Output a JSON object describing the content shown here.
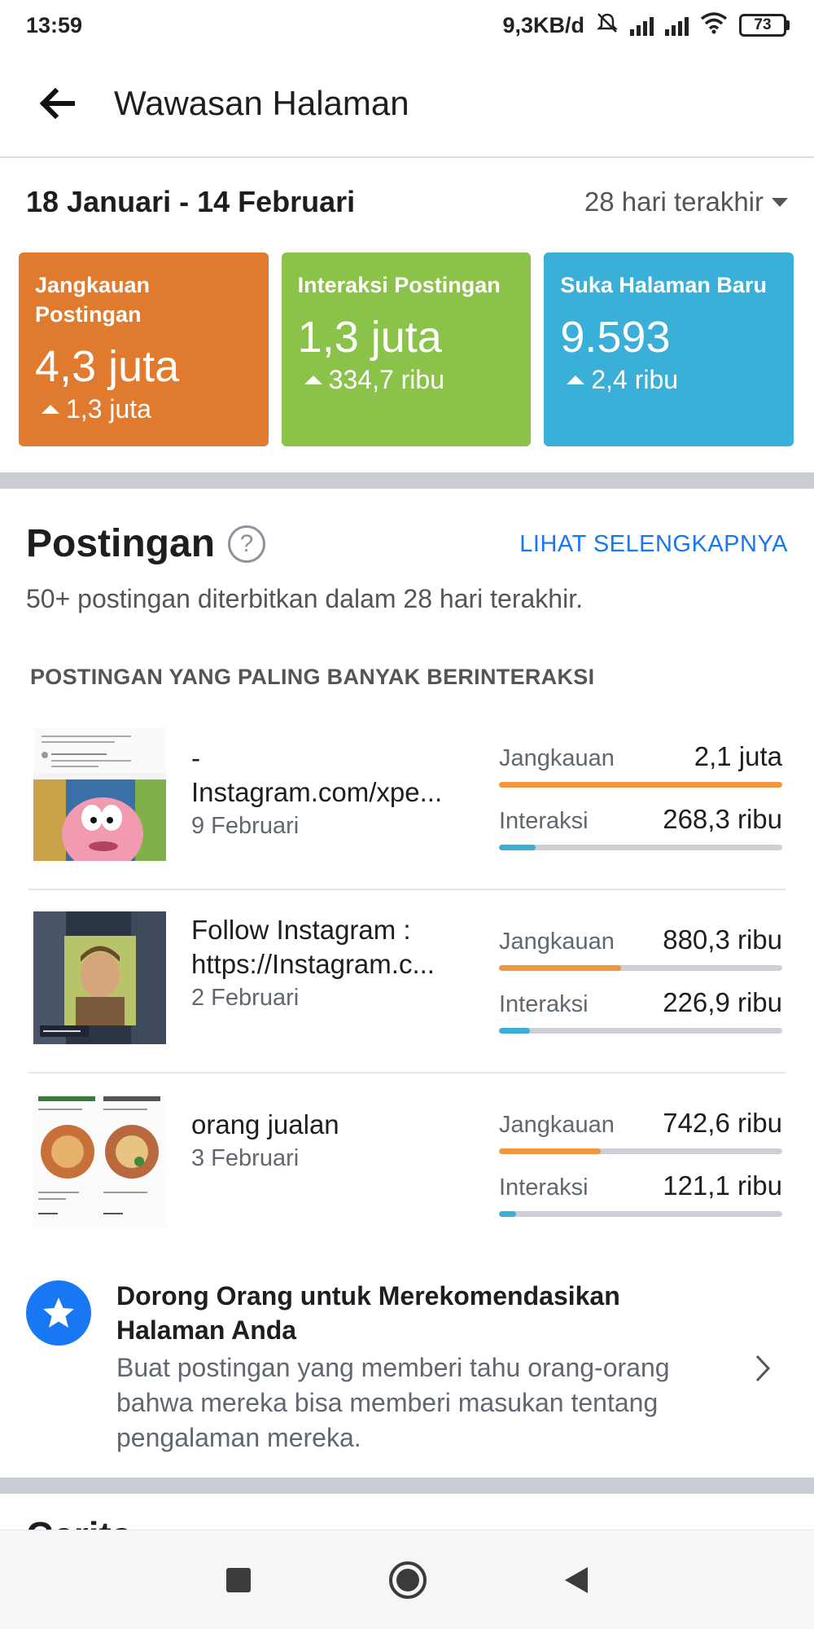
{
  "status_bar": {
    "time": "13:59",
    "network_speed": "9,3KB/d",
    "battery": "73"
  },
  "header": {
    "title": "Wawasan Halaman"
  },
  "date_range": {
    "label": "18 Januari - 14 Februari",
    "period": "28 hari terakhir"
  },
  "cards": [
    {
      "label": "Jangkauan Postingan",
      "value": "4,3 juta",
      "delta": "1,3 juta",
      "color": "#e07a2e"
    },
    {
      "label": "Interaksi Postingan",
      "value": "1,3 juta",
      "delta": "334,7 ribu",
      "color": "#8bc34a"
    },
    {
      "label": "Suka Halaman Baru",
      "value": "9.593",
      "delta": "2,4 ribu",
      "color": "#3ab0d8"
    }
  ],
  "posts_section": {
    "title": "Postingan",
    "see_all": "LIHAT SELENGKAPNYA",
    "subtitle": "50+ postingan diterbitkan dalam 28 hari terakhir.",
    "list_header": "POSTINGAN YANG PALING BANYAK BERINTERAKSI",
    "posts": [
      {
        "title_line1": "-",
        "title_line2": "Instagram.com/xpe...",
        "date": "9 Februari",
        "reach_label": "Jangkauan",
        "reach": "2,1 juta",
        "reach_fraction": 1.0,
        "interaction_label": "Interaksi",
        "interaction": "268,3 ribu",
        "interaction_fraction": 0.13
      },
      {
        "title_line1": "Follow Instagram :",
        "title_line2": "https://Instagram.c...",
        "date": "2 Februari",
        "reach_label": "Jangkauan",
        "reach": "880,3 ribu",
        "reach_fraction": 0.43,
        "interaction_label": "Interaksi",
        "interaction": "226,9 ribu",
        "interaction_fraction": 0.11
      },
      {
        "title_line1": "",
        "title_line2": "orang jualan",
        "date": "3 Februari",
        "reach_label": "Jangkauan",
        "reach": "742,6 ribu",
        "reach_fraction": 0.36,
        "interaction_label": "Interaksi",
        "interaction": "121,1 ribu",
        "interaction_fraction": 0.06
      }
    ]
  },
  "recommend": {
    "title": "Dorong Orang untuk Merekomendasikan Halaman Anda",
    "body": "Buat postingan yang memberi tahu orang-orang bahwa mereka bisa memberi masukan tentang pengalaman mereka."
  },
  "colors": {
    "reach_bar": "#f0963c",
    "interaction_bar": "#3ab0d8",
    "link": "#1877f2"
  }
}
